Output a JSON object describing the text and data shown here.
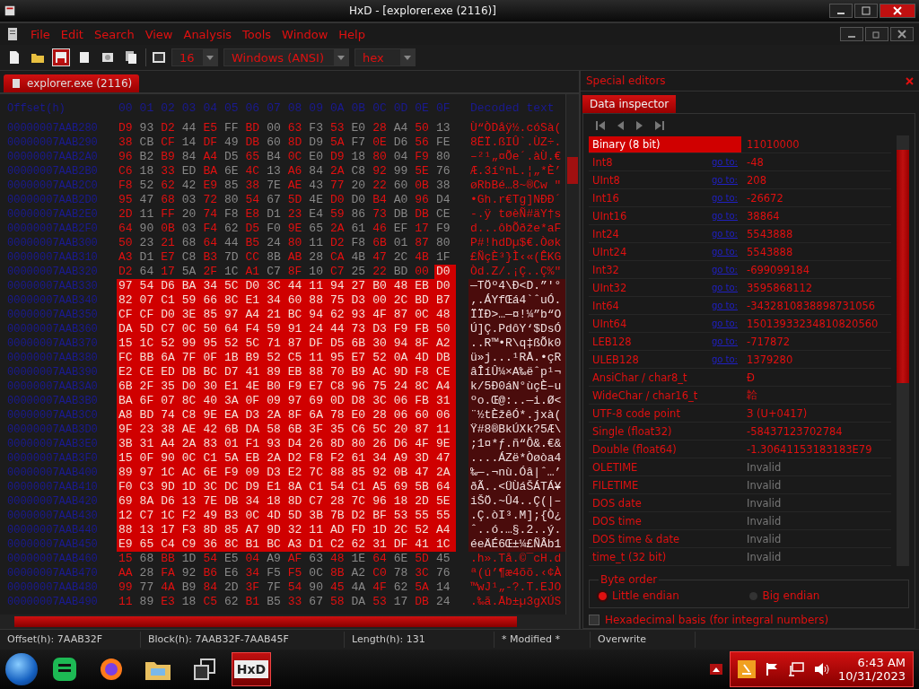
{
  "window": {
    "title": "HxD - [explorer.exe (2116)]"
  },
  "menu": [
    "File",
    "Edit",
    "Search",
    "View",
    "Analysis",
    "Tools",
    "Window",
    "Help"
  ],
  "toolbar": {
    "bytes_per_row": "16",
    "charset": "Windows (ANSI)",
    "offset_base": "hex"
  },
  "document_tab": {
    "label": "explorer.exe (2116)",
    "selected": true
  },
  "hex_view": {
    "offset_header": "Offset(h)",
    "columns": [
      "00",
      "01",
      "02",
      "03",
      "04",
      "05",
      "06",
      "07",
      "08",
      "09",
      "0A",
      "0B",
      "0C",
      "0D",
      "0E",
      "0F"
    ],
    "text_header": "Decoded text",
    "rows": [
      {
        "offset": "00000007AAB280",
        "bytes": "D9 93 D2 44 E5 FF BD 00 63 F3 53 E0 28 A4 50 13",
        "text": "Ù“ÒDåÿ½.cóSà(",
        "selected": false,
        "last_byte_selected": false
      },
      {
        "offset": "00000007AAB290",
        "bytes": "38 CB CF 14 DF 49 DB 60 8D D9 5A F7 0E D6 56 FE",
        "text": "8ËÏ.ßIÛ`.ÙZ÷.",
        "selected": false,
        "last_byte_selected": false
      },
      {
        "offset": "00000007AAB2A0",
        "bytes": "96 B2 B9 84 A4 D5 65 B4 0C E0 D9 18 80 04 F9 80",
        "text": "–²¹„¤Õe´.àÙ.€",
        "selected": false,
        "last_byte_selected": false
      },
      {
        "offset": "00000007AAB2B0",
        "bytes": "C6 18 33 ED BA 6E 4C 13 A6 84 2A C8 92 99 5E 76",
        "text": "Æ.3íºnL.¦„*È’",
        "selected": false,
        "last_byte_selected": false
      },
      {
        "offset": "00000007AAB2C0",
        "bytes": "F8 52 62 42 E9 85 38 7E AE 43 77 20 22 60 0B 38",
        "text": "øRbBé…8~®Cw \"",
        "selected": false,
        "last_byte_selected": false
      },
      {
        "offset": "00000007AAB2D0",
        "bytes": "95 47 68 03 72 80 54 67 5D 4E D0 D0 B4 A0 96 D4",
        "text": "•Gh.r€Tg]NÐÐ´",
        "selected": false,
        "last_byte_selected": false
      },
      {
        "offset": "00000007AAB2E0",
        "bytes": "2D 11 FF 20 74 F8 E8 D1 23 E4 59 86 73 DB DB CE",
        "text": "-.ÿ tøèÑ#äY†s",
        "selected": false,
        "last_byte_selected": false
      },
      {
        "offset": "00000007AAB2F0",
        "bytes": "64 90 0B 03 F4 62 D5 F0 9E 65 2A 61 46 EF 17 F9",
        "text": "d...ôbÕðže*aF",
        "selected": false,
        "last_byte_selected": false
      },
      {
        "offset": "00000007AAB300",
        "bytes": "50 23 21 68 64 44 B5 24 80 11 D2 F8 6B 01 87 80",
        "text": "P#!hdDµ$€.Òøk",
        "selected": false,
        "last_byte_selected": false
      },
      {
        "offset": "00000007AAB310",
        "bytes": "A3 D1 E7 C8 B3 7D CC 8B AB 28 CA 4B 47 2C 4B 1F",
        "text": "£ÑçÈ³}Ì‹«(ÊKG",
        "selected": false,
        "last_byte_selected": false
      },
      {
        "offset": "00000007AAB320",
        "bytes": "D2 64 17 5A 2F 1C A1 C7 8F 10 C7 25 22 BD 00 D0",
        "text": "Òd.Z/.¡Ç..Ç%\"",
        "selected": false,
        "last_byte_selected": true
      },
      {
        "offset": "00000007AAB330",
        "bytes": "97 54 D6 BA 34 5C D0 3C 44 11 94 27 B0 48 EB D0",
        "text": "—TÖº4\\Ð<D.”'°",
        "selected": true,
        "last_byte_selected": true
      },
      {
        "offset": "00000007AAB340",
        "bytes": "82 07 C1 59 66 8C E1 34 60 88 75 D3 00 2C BD B7",
        "text": "‚.ÁYfŒá4`ˆuÓ.",
        "selected": true,
        "last_byte_selected": true
      },
      {
        "offset": "00000007AAB350",
        "bytes": "CF CF D0 3E 85 97 A4 21 BC 94 62 93 4F 87 0C 48",
        "text": "ÏÏÐ>…—¤!¼”b“O",
        "selected": true,
        "last_byte_selected": true
      },
      {
        "offset": "00000007AAB360",
        "bytes": "DA 5D C7 0C 50 64 F4 59 91 24 44 73 D3 F9 FB 50",
        "text": "Ú]Ç.PdôY‘$DsÓ",
        "selected": true,
        "last_byte_selected": true
      },
      {
        "offset": "00000007AAB370",
        "bytes": "15 1C 52 99 95 52 5C 71 87 DF D5 6B 30 94 8F A2",
        "text": "..R™•R\\q‡ßÕk0",
        "selected": true,
        "last_byte_selected": true
      },
      {
        "offset": "00000007AAB380",
        "bytes": "FC BB 6A 7F 0F 1B B9 52 C5 11 95 E7 52 0A 4D DB",
        "text": "ü»j...¹RÅ.•çR",
        "selected": true,
        "last_byte_selected": true
      },
      {
        "offset": "00000007AAB390",
        "bytes": "E2 CE ED DB BC D7 41 89 EB 88 70 B9 AC 9D F8 CE",
        "text": "âÎíÛ¼×A‰ëˆp¹¬",
        "selected": true,
        "last_byte_selected": true
      },
      {
        "offset": "00000007AAB3A0",
        "bytes": "6B 2F 35 D0 30 E1 4E B0 F9 E7 C8 96 75 24 8C A4",
        "text": "k/5Ð0áN°ùçÈ–u",
        "selected": true,
        "last_byte_selected": true
      },
      {
        "offset": "00000007AAB3B0",
        "bytes": "BA 6F 07 8C 40 3A 0F 09 97 69 0D D8 3C 06 FB 31",
        "text": "ºo.Œ@:..—i.Ø<",
        "selected": true,
        "last_byte_selected": true
      },
      {
        "offset": "00000007AAB3C0",
        "bytes": "A8 BD 74 C8 9E EA D3 2A 8F 6A 78 E0 28 06 60 06",
        "text": "¨½tÈžêÓ*.jxà(",
        "selected": true,
        "last_byte_selected": true
      },
      {
        "offset": "00000007AAB3D0",
        "bytes": "9F 23 38 AE 42 6B DA 58 6B 3F 35 C6 5C 20 87 11",
        "text": "Ÿ#8®BkÚXk?5Æ\\",
        "selected": true,
        "last_byte_selected": true
      },
      {
        "offset": "00000007AAB3E0",
        "bytes": "3B 31 A4 2A 83 01 F1 93 D4 26 8D 80 26 D6 4F 9E",
        "text": ";1¤*ƒ.ñ“Ô&.€&",
        "selected": true,
        "last_byte_selected": true
      },
      {
        "offset": "00000007AAB3F0",
        "bytes": "15 0F 90 0C C1 5A EB 2A D2 F8 F2 61 34 A9 3D 47",
        "text": "....ÁZë*Òøòa4",
        "selected": true,
        "last_byte_selected": true
      },
      {
        "offset": "00000007AAB400",
        "bytes": "89 97 1C AC 6E F9 09 D3 E2 7C 88 85 92 0B 47 2A",
        "text": "‰—.¬nù.Óâ|ˆ…’",
        "selected": true,
        "last_byte_selected": true
      },
      {
        "offset": "00000007AAB410",
        "bytes": "F0 C3 9D 1D 3C DC D9 E1 8A C1 54 C1 A5 69 5B 64",
        "text": "ðÃ..<ÜÙáŠÁTÁ¥",
        "selected": true,
        "last_byte_selected": true
      },
      {
        "offset": "00000007AAB420",
        "bytes": "69 8A D6 13 7E DB 34 18 8D C7 28 7C 96 18 2D 5E",
        "text": "iŠÖ.~Û4..Ç(|–",
        "selected": true,
        "last_byte_selected": true
      },
      {
        "offset": "00000007AAB430",
        "bytes": "12 C7 1C F2 49 B3 0C 4D 5D 3B 7B D2 BF 53 55 55",
        "text": ".Ç.òI³.M];{Ò¿",
        "selected": true,
        "last_byte_selected": true
      },
      {
        "offset": "00000007AAB440",
        "bytes": "88 13 17 F3 8D 85 A7 9D 32 11 AD FD 1D 2C 52 A4",
        "text": "ˆ..ó.…§.2..ý.",
        "selected": true,
        "last_byte_selected": true
      },
      {
        "offset": "00000007AAB450",
        "bytes": "E9 65 C4 C9 36 8C B1 BC A3 D1 C2 62 31 DF 41 1C",
        "text": "éeÄÉ6Œ±¼£ÑÂb1",
        "selected": true,
        "last_byte_selected": true
      },
      {
        "offset": "00000007AAB460",
        "bytes": "15 68 BB 1D 54 E5 04 A9 AF 63 48 1E 64 6E 5D 45",
        "text": ".h».Tå.©¯cH.d",
        "selected": false,
        "last_byte_selected": false
      },
      {
        "offset": "00000007AAB470",
        "bytes": "AA 28 FA 92 B6 E6 34 F5 F5 0C 8B A2 C0 78 3C 76",
        "text": "ª(ú’¶æ4õõ.‹¢À",
        "selected": false,
        "last_byte_selected": false
      },
      {
        "offset": "00000007AAB480",
        "bytes": "99 77 4A B9 84 2D 3F 7F 54 90 45 4A 4F 62 5A 14",
        "text": "™wJ¹„-?.T.EJO",
        "selected": false,
        "last_byte_selected": false
      },
      {
        "offset": "00000007AAB490",
        "bytes": "11 89 E3 18 C5 62 B1 B5 33 67 58 DA 53 17 DB 24",
        "text": ".‰ã.Åb±µ3gXÚS",
        "selected": false,
        "last_byte_selected": false
      }
    ]
  },
  "special_editors": {
    "title": "Special editors",
    "tab": {
      "label": "Data inspector",
      "selected": true
    },
    "rows": [
      {
        "name": "Binary (8 bit)",
        "value": "11010000",
        "selected": true,
        "disabled": false
      },
      {
        "name": "Int8",
        "link": "go to:",
        "value": "-48",
        "selected": false,
        "disabled": false
      },
      {
        "name": "UInt8",
        "link": "go to:",
        "value": "208",
        "selected": false,
        "disabled": false
      },
      {
        "name": "Int16",
        "link": "go to:",
        "value": "-26672",
        "selected": false,
        "disabled": false
      },
      {
        "name": "UInt16",
        "link": "go to:",
        "value": "38864",
        "selected": false,
        "disabled": false
      },
      {
        "name": "Int24",
        "link": "go to:",
        "value": "5543888",
        "selected": false,
        "disabled": false
      },
      {
        "name": "UInt24",
        "link": "go to:",
        "value": "5543888",
        "selected": false,
        "disabled": false
      },
      {
        "name": "Int32",
        "link": "go to:",
        "value": "-699099184",
        "selected": false,
        "disabled": false
      },
      {
        "name": "UInt32",
        "link": "go to:",
        "value": "3595868112",
        "selected": false,
        "disabled": false
      },
      {
        "name": "Int64",
        "link": "go to:",
        "value": "-3432810838898731056",
        "selected": false,
        "disabled": false
      },
      {
        "name": "UInt64",
        "link": "go to:",
        "value": "15013933234810820560",
        "selected": false,
        "disabled": false
      },
      {
        "name": "LEB128",
        "link": "go to:",
        "value": "-717872",
        "selected": false,
        "disabled": false
      },
      {
        "name": "ULEB128",
        "link": "go to:",
        "value": "1379280",
        "selected": false,
        "disabled": false
      },
      {
        "name": "AnsiChar / char8_t",
        "value": "Ð",
        "selected": false,
        "disabled": false
      },
      {
        "name": "WideChar / char16_t",
        "value": "韐",
        "selected": false,
        "disabled": false
      },
      {
        "name": "UTF-8 code point",
        "value": "З (U+0417)",
        "selected": false,
        "disabled": false
      },
      {
        "name": "Single (float32)",
        "value": "-58437123702784",
        "selected": false,
        "disabled": false
      },
      {
        "name": "Double (float64)",
        "value": "-1.30641153183183E79",
        "selected": false,
        "disabled": false
      },
      {
        "name": "OLETIME",
        "value": "Invalid",
        "selected": false,
        "disabled": true
      },
      {
        "name": "FILETIME",
        "value": "Invalid",
        "selected": false,
        "disabled": true
      },
      {
        "name": "DOS date",
        "value": "Invalid",
        "selected": false,
        "disabled": true
      },
      {
        "name": "DOS time",
        "value": "Invalid",
        "selected": false,
        "disabled": true
      },
      {
        "name": "DOS time & date",
        "value": "Invalid",
        "selected": false,
        "disabled": true
      },
      {
        "name": "time_t (32 bit)",
        "value": "Invalid",
        "selected": false,
        "disabled": true
      }
    ],
    "byte_order": {
      "title": "Byte order",
      "options": [
        {
          "label": "Little endian",
          "selected": true
        },
        {
          "label": "Big endian",
          "selected": false
        }
      ]
    },
    "hex_basis": {
      "label": "Hexadecimal basis (for integral numbers)",
      "checked": false
    }
  },
  "status_bar": [
    "Offset(h): 7AAB32F",
    "Block(h): 7AAB32F-7AAB45F",
    "Length(h): 131",
    "* Modified *",
    "Overwrite"
  ],
  "taskbar": {
    "apps": [
      {
        "kind": "chat",
        "active": false
      },
      {
        "kind": "browser",
        "active": false
      },
      {
        "kind": "folder",
        "active": false
      },
      {
        "kind": "windows",
        "active": false
      },
      {
        "kind": "hxd",
        "label": "HxD",
        "active": true
      }
    ],
    "time": "6:43 AM",
    "date": "10/31/2023"
  }
}
